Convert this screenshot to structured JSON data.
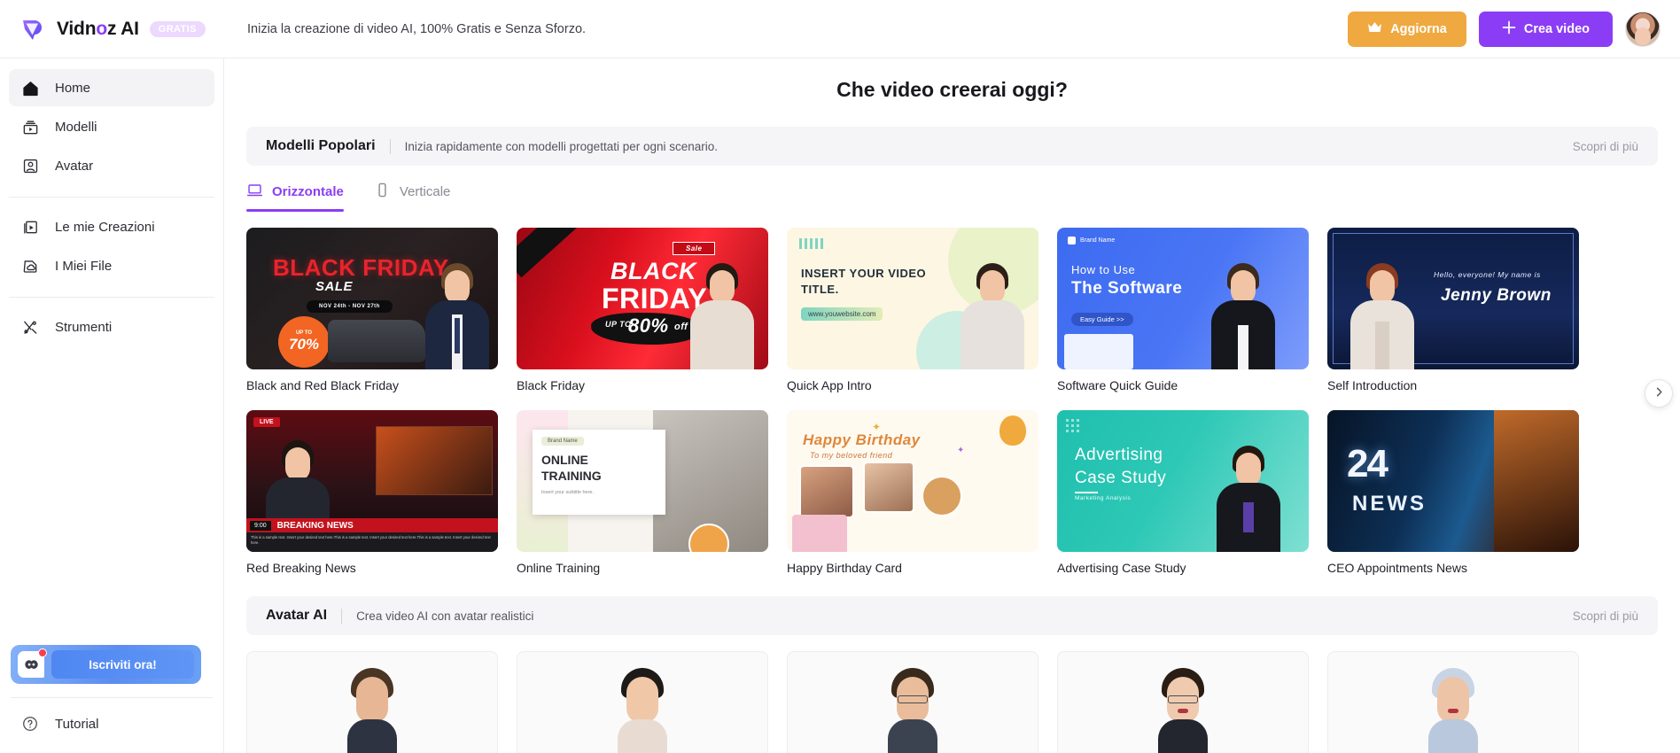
{
  "brand": {
    "name_part1": "Vidn",
    "name_o": "o",
    "name_part2": "z AI",
    "badge": "GRATIS",
    "logo_icon": "vidnoz-logo-icon"
  },
  "header": {
    "tagline": "Inizia la creazione di video AI, 100% Gratis e Senza Sforzo.",
    "upgrade_label": "Aggiorna",
    "upgrade_icon": "crown-icon",
    "create_label": "Crea video",
    "create_icon": "plus-icon",
    "avatar_name": "user-avatar"
  },
  "colors": {
    "accent_purple": "#8b3df5",
    "upgrade_orange": "#efa940",
    "badge_bg": "#ecd9fd",
    "panel_grey": "#f5f5f7",
    "discord_blue": "#5b8df0"
  },
  "sidebar": {
    "group1": [
      {
        "label": "Home",
        "icon": "home-icon",
        "active": true
      },
      {
        "label": "Modelli",
        "icon": "templates-icon",
        "active": false
      },
      {
        "label": "Avatar",
        "icon": "avatar-person-icon",
        "active": false
      }
    ],
    "group2": [
      {
        "label": "Le mie Creazioni",
        "icon": "my-creations-icon",
        "active": false
      },
      {
        "label": "I Miei File",
        "icon": "my-files-icon",
        "active": false
      }
    ],
    "group3": [
      {
        "label": "Strumenti",
        "icon": "tools-icon",
        "active": false
      }
    ],
    "discord": {
      "cta_label": "Iscriviti ora!",
      "icon": "discord-icon",
      "badge_dot": "notification-dot"
    },
    "tutorial": {
      "label": "Tutorial",
      "icon": "question-circle-icon"
    }
  },
  "main": {
    "page_title": "Che video creerai oggi?",
    "templates_section": {
      "title": "Modelli Popolari",
      "subtitle": "Inizia rapidamente con modelli progettati per ogni scenario.",
      "discover_label": "Scopri di più"
    },
    "tabs": [
      {
        "label": "Orizzontale",
        "icon": "laptop-icon",
        "active": true
      },
      {
        "label": "Verticale",
        "icon": "phone-icon",
        "active": false
      }
    ],
    "templates": [
      {
        "label": "Black and Red Black Friday",
        "art": "black-friday-sale"
      },
      {
        "label": "Black Friday",
        "art": "black-friday-red"
      },
      {
        "label": "Quick App Intro",
        "art": "app-intro"
      },
      {
        "label": "Software Quick Guide",
        "art": "software-guide"
      },
      {
        "label": "Self Introduction",
        "art": "self-intro"
      },
      {
        "label": "Red Breaking News",
        "art": "breaking-news"
      },
      {
        "label": "Online Training",
        "art": "online-training"
      },
      {
        "label": "Happy Birthday Card",
        "art": "birthday"
      },
      {
        "label": "Advertising Case Study",
        "art": "advertising"
      },
      {
        "label": "CEO Appointments News",
        "art": "news-24"
      }
    ],
    "template_art_text": {
      "black-friday-sale": {
        "line1": "BLACK FRIDAY",
        "line2": "SALE",
        "line3": "NOV 24th - NOV 27th",
        "badge_top": "UP TO",
        "badge_val": "70%"
      },
      "black-friday-red": {
        "line0": "Sale",
        "line1": "BLACK",
        "line2": "FRIDAY",
        "line3": "UP TO",
        "line4": "80%",
        "line5": "off"
      },
      "app-intro": {
        "line1": "INSERT YOUR VIDEO",
        "line2": "TITLE.",
        "chip": "www.youwebsite.com"
      },
      "software-guide": {
        "brand": "Brand Name",
        "line1": "How to Use",
        "line2": "The Software",
        "chip": "Easy Guide >>"
      },
      "self-intro": {
        "line1": "Hello, everyone! My name is",
        "line2": "Jenny Brown"
      },
      "breaking-news": {
        "tag": "LIVE",
        "line1": "BREAKING NEWS",
        "time": "9:00",
        "ticker": "This is a sample text. Insert your desired text here.This is a sample text. Insert your desired text here.This is a sample text. Insert your desired text here."
      },
      "online-training": {
        "chip": "Brand Name",
        "line1": "ONLINE",
        "line2": "TRAINING",
        "line3": "Insert your subtitle here."
      },
      "birthday": {
        "line1": "Happy Birthday",
        "line2": "To my beloved friend"
      },
      "advertising": {
        "line1": "Advertising",
        "line2": "Case Study",
        "line3": "Marketing Analysis"
      },
      "news-24": {
        "line1": "24",
        "line2": "NEWS"
      }
    },
    "carousel_next_icon": "chevron-right-icon",
    "avatar_section": {
      "title": "Avatar AI",
      "subtitle": "Crea video AI con avatar realistici",
      "discover_label": "Scopri di più"
    },
    "avatars": [
      {
        "name": "avatar-1",
        "hair": "#4a3524",
        "skin": "#e7b694",
        "body": "#2d3340",
        "glasses": false,
        "lips": false
      },
      {
        "name": "avatar-2",
        "hair": "#1e1a17",
        "skin": "#f0c8a8",
        "body": "#e8dcd2",
        "glasses": false,
        "lips": false
      },
      {
        "name": "avatar-3",
        "hair": "#3a2a1c",
        "skin": "#e9bd9b",
        "body": "#3b4250",
        "glasses": true,
        "lips": false
      },
      {
        "name": "avatar-4",
        "hair": "#2a1d14",
        "skin": "#efcaae",
        "body": "#23262e",
        "glasses": true,
        "lips": true
      },
      {
        "name": "avatar-5",
        "hair": "#c8d4e4",
        "skin": "#edc4a6",
        "body": "#b9c8dc",
        "glasses": false,
        "lips": true
      }
    ]
  }
}
